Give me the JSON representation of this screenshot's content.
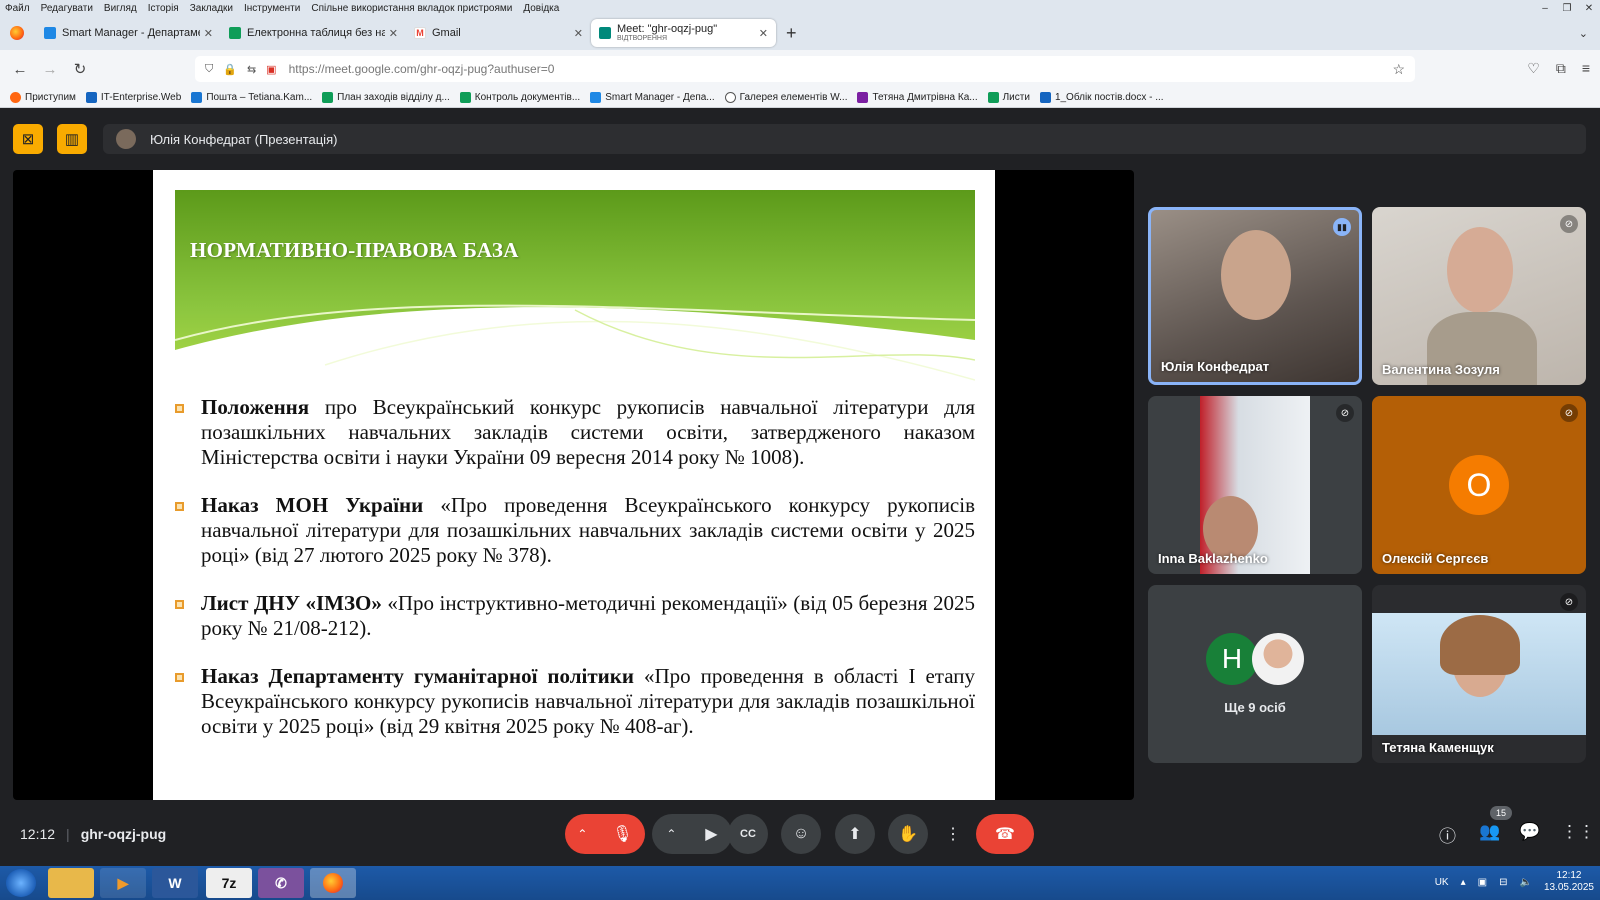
{
  "os_menu": [
    "Файл",
    "Редагувати",
    "Вигляд",
    "Історія",
    "Закладки",
    "Інструменти",
    "Спільне використання вкладок пристроями",
    "Довідка"
  ],
  "window_controls": [
    "–",
    "❐",
    "✕"
  ],
  "tabs": [
    {
      "label": "Smart Manager - Департамент",
      "color": "#1e88e5"
    },
    {
      "label": "Електронна таблиця без назви",
      "color": "#0f9d58"
    },
    {
      "label": "Gmail",
      "color": "#ea4335"
    },
    {
      "label": "Meet: \"ghr-oqzj-pug\"",
      "sub": "ВІДТВОРЕННЯ",
      "color": "#00897b"
    }
  ],
  "url": "https://meet.google.com/ghr-oqzj-pug?authuser=0",
  "bookmarks": [
    {
      "label": "Приступим",
      "color": "#ff6611"
    },
    {
      "label": "IT-Enterprise.Web",
      "color": "#1565c0"
    },
    {
      "label": "Пошта – Tetiana.Kam...",
      "color": "#1976d2"
    },
    {
      "label": "План заходів відділу д...",
      "color": "#0f9d58"
    },
    {
      "label": "Контроль документів...",
      "color": "#0f9d58"
    },
    {
      "label": "Smart Manager - Депа...",
      "color": "#1e88e5"
    },
    {
      "label": "Галерея елементів W...",
      "color": "#555555"
    },
    {
      "label": "Тетяна Дмитрівна Ка...",
      "color": "#7b1fa2"
    },
    {
      "label": "Листи",
      "color": "#0f9d58"
    },
    {
      "label": "1_Облік постів.docx - ...",
      "color": "#1565c0"
    }
  ],
  "presenter": {
    "text": "Юлія Конфедрат (Презентація)"
  },
  "slide": {
    "title": "НОРМАТИВНО-ПРАВОВА БАЗА",
    "items": [
      {
        "bold": "Положення",
        "text": " про Всеукраїнський конкурс рукописів навчальної літератури для позашкільних навчальних закладів системи освіти, затвердженого наказом Міністерства освіти і науки України 09 вересня 2014 року № 1008)."
      },
      {
        "bold": "Наказ МОН України",
        "text": " «Про проведення Всеукраїнського конкурсу рукописів навчальної літератури для позашкільних навчальних закладів системи освіти у 2025 році» (від 27 лютого 2025 року № 378)."
      },
      {
        "bold": "Лист ДНУ «ІМЗО»",
        "text": " «Про інструктивно-методичні рекомендації» (від 05 березня 2025 року № 21/08-212)."
      },
      {
        "bold": "Наказ Департаменту гуманітарної політики",
        "text": " «Про проведення в області І етапу Всеукраїнського конкурсу рукописів навчальної літератури для закладів позашкільної освіти у 2025 році» (від 29 квітня 2025 року № 408-аг)."
      }
    ]
  },
  "participants": [
    {
      "name": "Юлія Конфедрат"
    },
    {
      "name": "Валентина Зозуля"
    },
    {
      "name": "Inna Baklazhenko"
    },
    {
      "name": "Олексій Сергєєв",
      "initial": "О"
    },
    {
      "name": "Ще 9 осіб",
      "initial": "Н"
    },
    {
      "name": "Тетяна Каменщук"
    }
  ],
  "meeting": {
    "time": "12:12",
    "code": "ghr-oqzj-pug",
    "people_count": "15"
  },
  "taskbar": {
    "lang": "UK",
    "time": "12:12",
    "date": "13.05.2025",
    "apps": [
      "W",
      "7z"
    ]
  }
}
